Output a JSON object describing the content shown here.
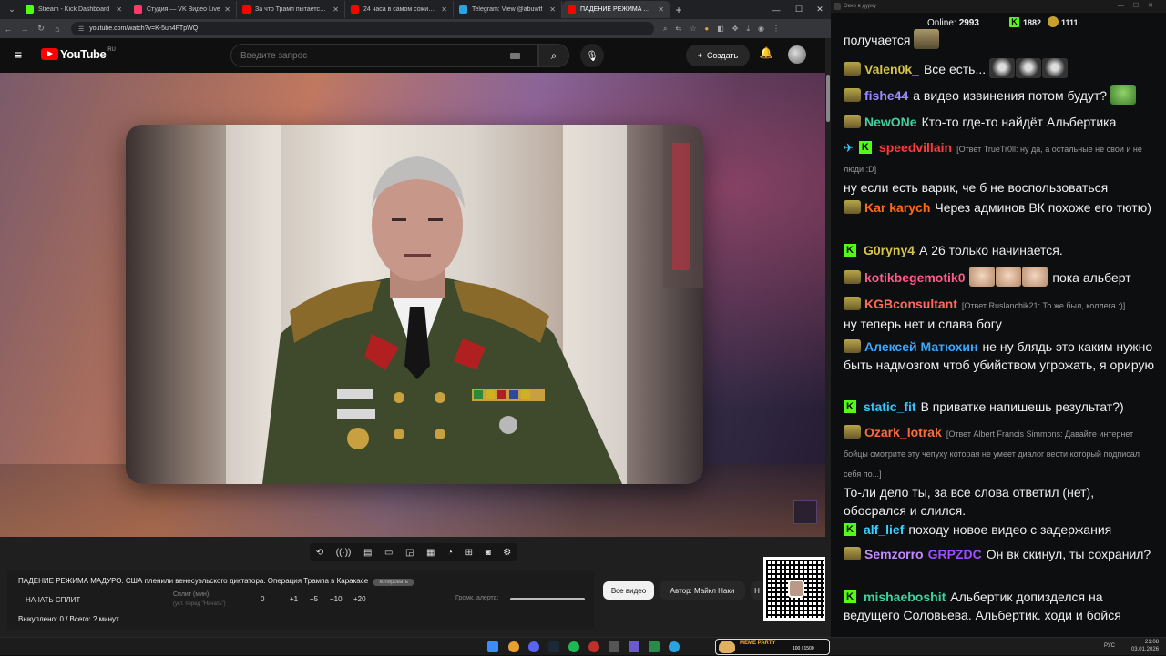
{
  "browser": {
    "tabs": [
      {
        "title": "Stream - Kick Dashboard",
        "color": "#53fc18",
        "active": false
      },
      {
        "title": "Студия — VK Видео Live",
        "color": "#ff3a66",
        "active": false
      },
      {
        "title": "За что Трамп пытается убить",
        "color": "#ff0000",
        "active": false
      },
      {
        "title": "24 часа в самом сожиревшем",
        "color": "#ff0000",
        "active": false
      },
      {
        "title": "Telegram: View @abuwtf",
        "color": "#2aa3e3",
        "active": false
      },
      {
        "title": "ПАДЕНИЕ РЕЖИМА МАДУ...",
        "color": "#ff0000",
        "active": true
      }
    ],
    "url": "youtube.com/watch?v=K-5un4FTpWQ"
  },
  "youtube": {
    "logo_text": "YouTube",
    "region": "RU",
    "search_placeholder": "Введите запрос",
    "create_label": "Создать"
  },
  "panel": {
    "video_title": "ПАДЕНИЕ РЕЖИМА МАДУРО. США пленили венесуэльского диктатора. Операция Трампа в Каракасе",
    "pill_label": "копировать",
    "split_button": "НАЧАТЬ СПЛИТ",
    "split_label": "Сплит (мин):",
    "split_sub": "(уст. перед \"Начать\")",
    "split_value": "0",
    "increments": [
      "+1",
      "+5",
      "+10",
      "+20"
    ],
    "volume_label": "Громк. алерта:",
    "sold_text": "Выкуплено: 0 / Всего: ? минут",
    "volume_level": 1.0
  },
  "video_buttons": {
    "all": "Все видео",
    "author": "Автор: Майкл Наки",
    "more": "Н"
  },
  "chat": {
    "window_title": "Окно в дурку",
    "online_label": "Online:",
    "online_count": "2993",
    "kick_count": "1882",
    "other_count": "1111",
    "messages": [
      {
        "text": "получается"
      },
      {
        "name": "Valen0k_",
        "color": "#d6c54a",
        "text": "Все есть..."
      },
      {
        "name": "fishe44",
        "color": "#9c8cff",
        "text": "а видео извинения потом будут?"
      },
      {
        "name": "NewONe",
        "color": "#3fd29c",
        "text": "Кто-то где-то найдёт Альбертика"
      },
      {
        "name": "speedvillain",
        "color": "#ff3a3a",
        "reply": "[Ответ TrueTr0ll: ну да, а остальные не свои и не люди :D]",
        "text": "ну если есть варик, че б не воспользоваться"
      },
      {
        "name": "Kar karych",
        "color": "#ff6a1a",
        "text": "Через админов ВК похоже его тютю)"
      },
      {
        "name": "G0ryny4",
        "color": "#d6c54a",
        "text": "А 26 только начинается."
      },
      {
        "name": "kotikbegemotik0",
        "color": "#ff5a8a",
        "text": "пока альберт"
      },
      {
        "name": "KGBconsultant",
        "color": "#ff6a5a",
        "reply": "[Ответ Ruslanchik21: То же был, коллега :)]",
        "text": "ну теперь нет и слава богу"
      },
      {
        "name": "Алексей Матюхин",
        "color": "#3aa8ff",
        "text": "не ну блядь это каким нужно быть надмозгом чтоб убийством угрожать, я орирую"
      },
      {
        "name": "static_fit",
        "color": "#35c7ff",
        "text": "В приватке напишешь результат?)"
      },
      {
        "name": "Ozark_lotrak",
        "color": "#ff6a3a",
        "reply": "[Ответ Albert Francis Simmons: Давайте интернет бойцы смотрите  эту чепуху которая не умеет диалог вести который подписал себя по...]",
        "text": "То-ли дело ты, за все слова ответил (нет), обосрался и слился."
      },
      {
        "name": "alf_lief",
        "color": "#3ad0ff",
        "text": "походу новое видео с задержания"
      },
      {
        "name": "Semzorro",
        "color": "#c48aff",
        "badge": "GRPZDC",
        "badge_color": "#a14cff",
        "text": "Он вк скинул, ты сохранил?"
      },
      {
        "name": "mishaeboshit",
        "color": "#3fd29c",
        "text": "Альбертик допизделся на ведущего Соловьева. Альбертик. ходи и бойся"
      }
    ]
  },
  "taskbar": {
    "widget_title": "МЕМЕ PARTY",
    "widget_progress": "100 / 1500",
    "lang": "РУС",
    "time": "21:08",
    "date": "03.01.2026"
  }
}
